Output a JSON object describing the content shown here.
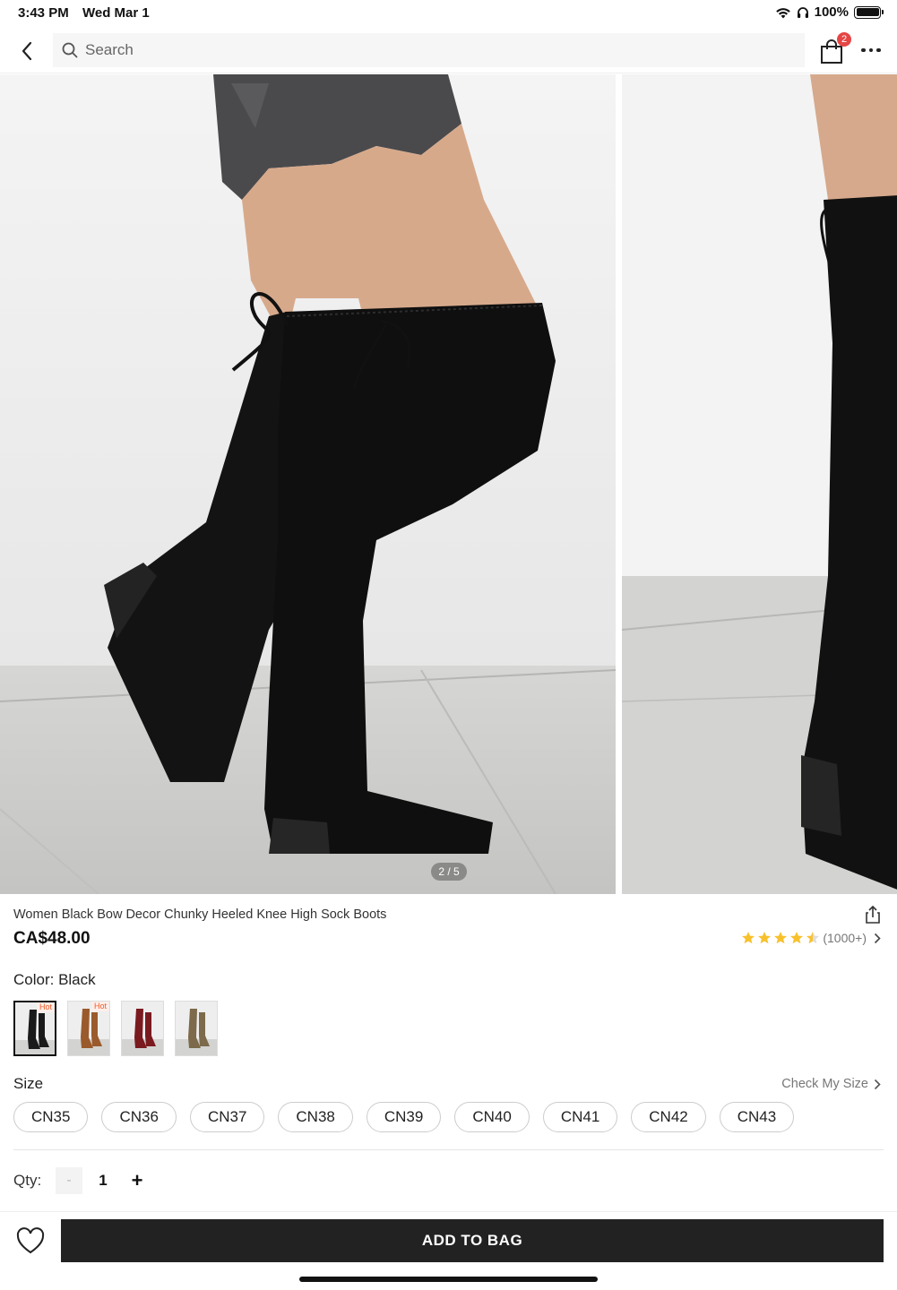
{
  "status_bar": {
    "time": "3:43 PM",
    "date": "Wed Mar 1",
    "battery": "100%",
    "icons": [
      "wifi-icon",
      "headphones-icon",
      "battery-icon"
    ]
  },
  "nav": {
    "search_placeholder": "Search",
    "bag_count": "2",
    "icons": [
      "back-icon",
      "search-icon",
      "shopping-bag-icon",
      "more-icon"
    ]
  },
  "gallery": {
    "pager": "2 / 5",
    "current": 2,
    "total": 5
  },
  "product": {
    "title": "Women Black Bow Decor Chunky Heeled Knee High Sock Boots",
    "price": "CA$48.00",
    "rating_value": 4.5,
    "rating_count": "(1000+)"
  },
  "color": {
    "label": "Color: Black",
    "swatches": [
      {
        "name": "Black",
        "hex": "#1a1a1a",
        "hot": "Hot",
        "selected": true
      },
      {
        "name": "Brown",
        "hex": "#9a5a2c",
        "hot": "Hot",
        "selected": false
      },
      {
        "name": "Burgundy",
        "hex": "#7a1a1f",
        "hot": "",
        "selected": false
      },
      {
        "name": "Khaki",
        "hex": "#7c6a4a",
        "hot": "",
        "selected": false
      }
    ]
  },
  "size": {
    "label": "Size",
    "check_label": "Check My Size",
    "options": [
      "CN35",
      "CN36",
      "CN37",
      "CN38",
      "CN39",
      "CN40",
      "CN41",
      "CN42",
      "CN43"
    ]
  },
  "quantity": {
    "label": "Qty:",
    "minus": "-",
    "value": "1",
    "plus": "+"
  },
  "actions": {
    "add_to_bag": "ADD TO BAG"
  },
  "colors": {
    "accent": "#222222",
    "badge": "#e64545",
    "star": "#f8c12c",
    "hot_text": "#f05a28"
  }
}
